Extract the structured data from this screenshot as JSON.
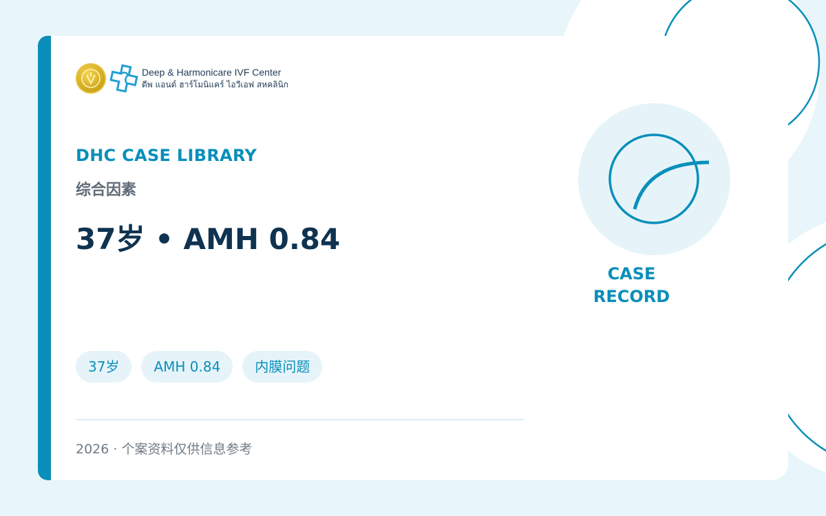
{
  "brand": {
    "name_en": "Deep & Harmonicare IVF Center",
    "name_th": "ดีพ แอนด์ ฮาร์โมนิแคร์ ไอวีเอฟ สหคลินิก"
  },
  "eyebrow": "DHC CASE LIBRARY",
  "category": "综合因素",
  "headline": "37岁 • AMH 0.84",
  "tags": [
    {
      "label": "37岁"
    },
    {
      "label": "AMH 0.84"
    },
    {
      "label": "内膜问题"
    }
  ],
  "footer": "2026 · 个案资料仅供信息参考",
  "side": {
    "label_line1": "CASE",
    "label_line2": "RECORD"
  },
  "colors": {
    "accent": "#0a8fba",
    "headline": "#0f3350",
    "background": "#e8f5fa",
    "card": "#ffffff"
  }
}
